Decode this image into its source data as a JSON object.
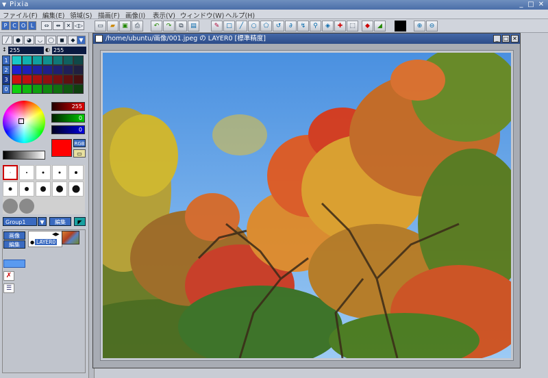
{
  "app": {
    "title": "Pixia"
  },
  "window_buttons": [
    "_",
    "□",
    "✕"
  ],
  "menu": [
    {
      "label": "ファイル(F)"
    },
    {
      "label": "編集(E)"
    },
    {
      "label": "領域(S)"
    },
    {
      "label": "描画(F)"
    },
    {
      "label": "画像(I)"
    },
    {
      "label": "表示(V)"
    },
    {
      "label": "ウィンドウ(W)"
    },
    {
      "label": "ヘルプ(H)"
    }
  ],
  "mode_buttons": [
    "P",
    "C",
    "O",
    "L"
  ],
  "color_tabs": [
    "1",
    "2",
    "3",
    "0"
  ],
  "tool_values": {
    "size": "255",
    "density": "255"
  },
  "channels": {
    "r": "255",
    "g": "0",
    "b": "0"
  },
  "rgb_label": "RGB",
  "current_color": "#ff0000",
  "palette_rows": [
    [
      "#18c8c8",
      "#10b0b0",
      "#10a0a0",
      "#109090",
      "#107878",
      "#106060",
      "#104848"
    ],
    [
      "#2020d0",
      "#2020b8",
      "#2020a0",
      "#202088",
      "#202070",
      "#202058",
      "#202040"
    ],
    [
      "#d01010",
      "#c01010",
      "#a81010",
      "#901010",
      "#781010",
      "#601010",
      "#481010"
    ],
    [
      "#10d010",
      "#10b810",
      "#10a010",
      "#108810",
      "#107010",
      "#105810",
      "#104010"
    ]
  ],
  "layer_group": {
    "name": "Group1",
    "edit_label": "編集"
  },
  "layers": {
    "image_btn": "画像",
    "edit_btn": "編集",
    "layer_name": "LAYER0"
  },
  "document": {
    "title": "/home/ubuntu/画像/001.jpeg の LAYER0 [標準精度]"
  }
}
